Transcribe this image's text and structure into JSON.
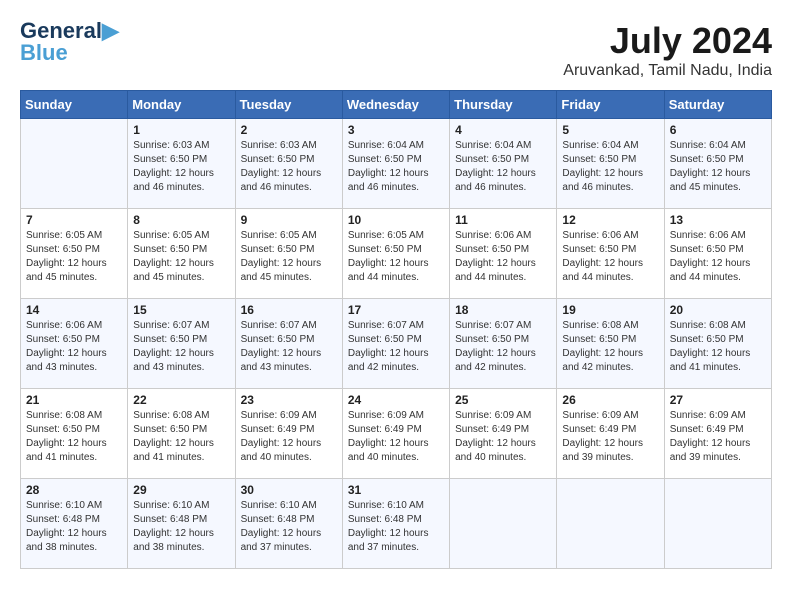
{
  "logo": {
    "line1": "General",
    "line2": "Blue"
  },
  "title": "July 2024",
  "location": "Aruvankad, Tamil Nadu, India",
  "days_header": [
    "Sunday",
    "Monday",
    "Tuesday",
    "Wednesday",
    "Thursday",
    "Friday",
    "Saturday"
  ],
  "weeks": [
    [
      {
        "num": "",
        "info": ""
      },
      {
        "num": "1",
        "info": "Sunrise: 6:03 AM\nSunset: 6:50 PM\nDaylight: 12 hours\nand 46 minutes."
      },
      {
        "num": "2",
        "info": "Sunrise: 6:03 AM\nSunset: 6:50 PM\nDaylight: 12 hours\nand 46 minutes."
      },
      {
        "num": "3",
        "info": "Sunrise: 6:04 AM\nSunset: 6:50 PM\nDaylight: 12 hours\nand 46 minutes."
      },
      {
        "num": "4",
        "info": "Sunrise: 6:04 AM\nSunset: 6:50 PM\nDaylight: 12 hours\nand 46 minutes."
      },
      {
        "num": "5",
        "info": "Sunrise: 6:04 AM\nSunset: 6:50 PM\nDaylight: 12 hours\nand 46 minutes."
      },
      {
        "num": "6",
        "info": "Sunrise: 6:04 AM\nSunset: 6:50 PM\nDaylight: 12 hours\nand 45 minutes."
      }
    ],
    [
      {
        "num": "7",
        "info": "Sunrise: 6:05 AM\nSunset: 6:50 PM\nDaylight: 12 hours\nand 45 minutes."
      },
      {
        "num": "8",
        "info": "Sunrise: 6:05 AM\nSunset: 6:50 PM\nDaylight: 12 hours\nand 45 minutes."
      },
      {
        "num": "9",
        "info": "Sunrise: 6:05 AM\nSunset: 6:50 PM\nDaylight: 12 hours\nand 45 minutes."
      },
      {
        "num": "10",
        "info": "Sunrise: 6:05 AM\nSunset: 6:50 PM\nDaylight: 12 hours\nand 44 minutes."
      },
      {
        "num": "11",
        "info": "Sunrise: 6:06 AM\nSunset: 6:50 PM\nDaylight: 12 hours\nand 44 minutes."
      },
      {
        "num": "12",
        "info": "Sunrise: 6:06 AM\nSunset: 6:50 PM\nDaylight: 12 hours\nand 44 minutes."
      },
      {
        "num": "13",
        "info": "Sunrise: 6:06 AM\nSunset: 6:50 PM\nDaylight: 12 hours\nand 44 minutes."
      }
    ],
    [
      {
        "num": "14",
        "info": "Sunrise: 6:06 AM\nSunset: 6:50 PM\nDaylight: 12 hours\nand 43 minutes."
      },
      {
        "num": "15",
        "info": "Sunrise: 6:07 AM\nSunset: 6:50 PM\nDaylight: 12 hours\nand 43 minutes."
      },
      {
        "num": "16",
        "info": "Sunrise: 6:07 AM\nSunset: 6:50 PM\nDaylight: 12 hours\nand 43 minutes."
      },
      {
        "num": "17",
        "info": "Sunrise: 6:07 AM\nSunset: 6:50 PM\nDaylight: 12 hours\nand 42 minutes."
      },
      {
        "num": "18",
        "info": "Sunrise: 6:07 AM\nSunset: 6:50 PM\nDaylight: 12 hours\nand 42 minutes."
      },
      {
        "num": "19",
        "info": "Sunrise: 6:08 AM\nSunset: 6:50 PM\nDaylight: 12 hours\nand 42 minutes."
      },
      {
        "num": "20",
        "info": "Sunrise: 6:08 AM\nSunset: 6:50 PM\nDaylight: 12 hours\nand 41 minutes."
      }
    ],
    [
      {
        "num": "21",
        "info": "Sunrise: 6:08 AM\nSunset: 6:50 PM\nDaylight: 12 hours\nand 41 minutes."
      },
      {
        "num": "22",
        "info": "Sunrise: 6:08 AM\nSunset: 6:50 PM\nDaylight: 12 hours\nand 41 minutes."
      },
      {
        "num": "23",
        "info": "Sunrise: 6:09 AM\nSunset: 6:49 PM\nDaylight: 12 hours\nand 40 minutes."
      },
      {
        "num": "24",
        "info": "Sunrise: 6:09 AM\nSunset: 6:49 PM\nDaylight: 12 hours\nand 40 minutes."
      },
      {
        "num": "25",
        "info": "Sunrise: 6:09 AM\nSunset: 6:49 PM\nDaylight: 12 hours\nand 40 minutes."
      },
      {
        "num": "26",
        "info": "Sunrise: 6:09 AM\nSunset: 6:49 PM\nDaylight: 12 hours\nand 39 minutes."
      },
      {
        "num": "27",
        "info": "Sunrise: 6:09 AM\nSunset: 6:49 PM\nDaylight: 12 hours\nand 39 minutes."
      }
    ],
    [
      {
        "num": "28",
        "info": "Sunrise: 6:10 AM\nSunset: 6:48 PM\nDaylight: 12 hours\nand 38 minutes."
      },
      {
        "num": "29",
        "info": "Sunrise: 6:10 AM\nSunset: 6:48 PM\nDaylight: 12 hours\nand 38 minutes."
      },
      {
        "num": "30",
        "info": "Sunrise: 6:10 AM\nSunset: 6:48 PM\nDaylight: 12 hours\nand 37 minutes."
      },
      {
        "num": "31",
        "info": "Sunrise: 6:10 AM\nSunset: 6:48 PM\nDaylight: 12 hours\nand 37 minutes."
      },
      {
        "num": "",
        "info": ""
      },
      {
        "num": "",
        "info": ""
      },
      {
        "num": "",
        "info": ""
      }
    ]
  ]
}
